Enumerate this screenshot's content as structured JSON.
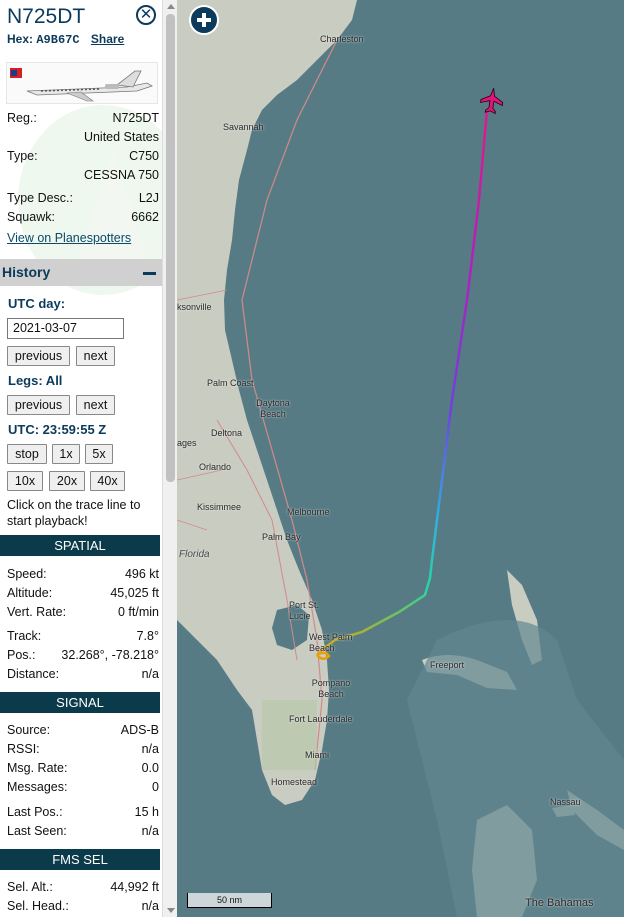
{
  "aircraft": {
    "callsign": "N725DT",
    "hex_label": "Hex:",
    "hex_value": "A9B67C",
    "share_label": "Share"
  },
  "details": {
    "reg_label": "Reg.:",
    "reg_value": "N725DT",
    "country": "United States",
    "type_label": "Type:",
    "type_value": "C750",
    "type_name": "CESSNA 750",
    "type_desc_label": "Type Desc.:",
    "type_desc_value": "L2J",
    "squawk_label": "Squawk:",
    "squawk_value": "6662",
    "planespotters_link": "View on Planespotters"
  },
  "history": {
    "title": "History",
    "utc_day_label": "UTC day:",
    "date_value": "2021-03-07",
    "previous_label": "previous",
    "next_label": "next",
    "legs_label": "Legs: All",
    "utc_time_label": "UTC: 23:59:55 Z",
    "speed_buttons": [
      "stop",
      "1x",
      "5x",
      "10x",
      "20x",
      "40x"
    ],
    "note": "Click on the trace line to start playback!"
  },
  "spatial": {
    "title": "SPATIAL",
    "rows": [
      {
        "label": "Speed:",
        "value": "496 kt"
      },
      {
        "label": "Altitude:",
        "value": "45,025 ft"
      },
      {
        "label": "Vert. Rate:",
        "value": "0 ft/min"
      },
      {
        "label": "Track:",
        "value": "7.8°"
      },
      {
        "label": "Pos.:",
        "value": "32.268°, -78.218°"
      },
      {
        "label": "Distance:",
        "value": "n/a"
      }
    ]
  },
  "signal": {
    "title": "SIGNAL",
    "rows": [
      {
        "label": "Source:",
        "value": "ADS-B"
      },
      {
        "label": "RSSI:",
        "value": "n/a"
      },
      {
        "label": "Msg. Rate:",
        "value": "0.0"
      },
      {
        "label": "Messages:",
        "value": "0"
      },
      {
        "label": "Last Pos.:",
        "value": "15 h"
      },
      {
        "label": "Last Seen:",
        "value": "n/a"
      }
    ]
  },
  "fms": {
    "title": "FMS SEL",
    "rows": [
      {
        "label": "Sel. Alt.:",
        "value": "44,992 ft"
      },
      {
        "label": "Sel. Head.:",
        "value": "n/a"
      }
    ]
  },
  "map": {
    "scale_label": "50 nm",
    "places": [
      "Charleston",
      "Savannah",
      "ksonville",
      "Palm Coast",
      "Daytona Beach",
      "ages",
      "Deltona",
      "Orlando",
      "Kissimmee",
      "Melbourne",
      "Palm Bay",
      "Florida",
      "Port St. Lucie",
      "West Palm Beach",
      "Pompano Beach",
      "Fort Lauderdale",
      "Miami",
      "Homestead",
      "Freeport",
      "Nassau",
      "The Bahamas"
    ],
    "colors": {
      "sea": "#577b84",
      "land": "#c9ccc1",
      "trace_start": "#e8a000",
      "trace_mid": "#2ad4a0",
      "trace_high": "#7040e0",
      "trace_end": "#e01a8a"
    }
  }
}
